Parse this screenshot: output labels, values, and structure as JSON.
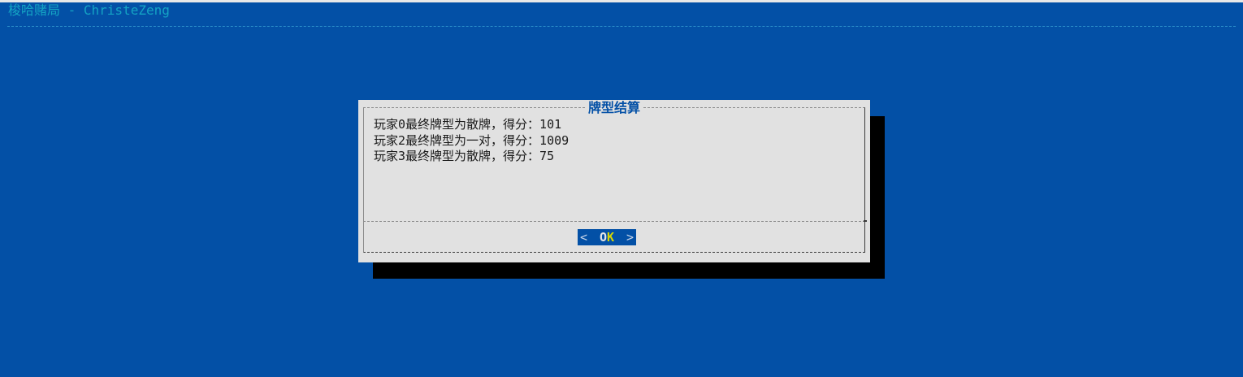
{
  "window": {
    "backtitle": "梭哈赌局 - ChristeZeng"
  },
  "dialog": {
    "title": "牌型结算",
    "lines": [
      "玩家0最终牌型为散牌，得分：101",
      "玩家2最终牌型为一对，得分：1009",
      "玩家3最终牌型为散牌，得分：75"
    ],
    "button": {
      "left_arrow": "<",
      "label_first": "O",
      "label_rest": "K",
      "right_arrow": ">"
    }
  },
  "colors": {
    "background": "#0350a6",
    "backtitle": "#14a4c4",
    "dialog_bg": "#e1e1e1",
    "shadow": "#000000",
    "hotkey": "#d8d800"
  }
}
